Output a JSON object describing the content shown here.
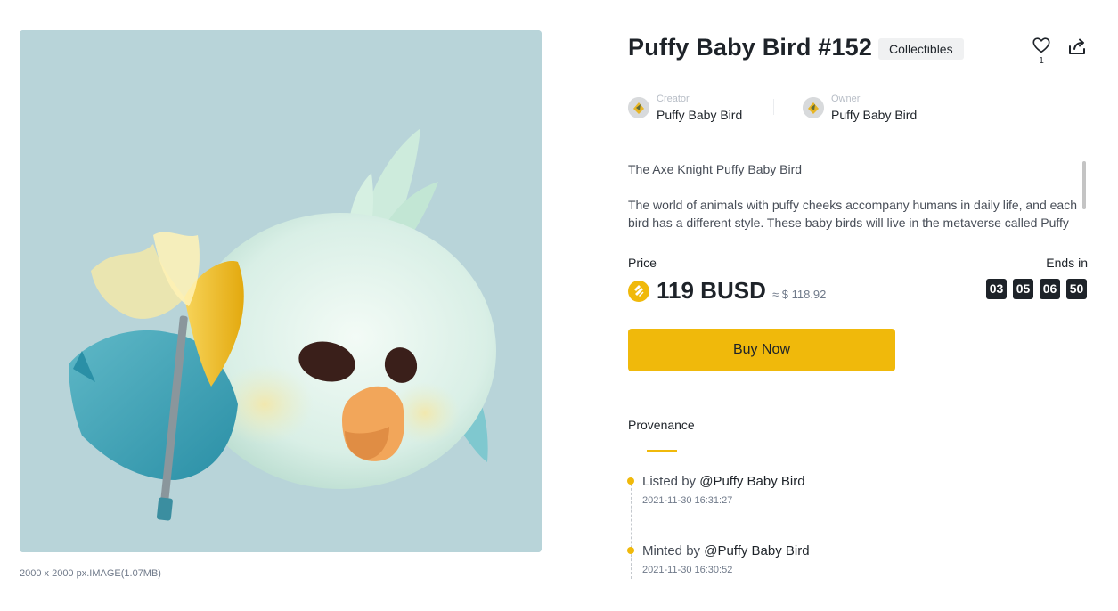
{
  "artwork": {
    "alt": "Puffy Baby Bird #152 artwork",
    "size_info": "2000 x 2000 px.IMAGE(1.07MB)"
  },
  "nft": {
    "title": "Puffy Baby Bird #152",
    "category": "Collectibles",
    "likes": "1"
  },
  "creator": {
    "role": "Creator",
    "name": "Puffy Baby Bird"
  },
  "owner": {
    "role": "Owner",
    "name": "Puffy Baby Bird"
  },
  "description": {
    "line1": "The Axe Knight Puffy Baby Bird",
    "line2": "The world of animals with puffy cheeks accompany humans in daily life, and each bird has a different style. These baby birds will live in the metaverse called Puffy"
  },
  "price": {
    "label": "Price",
    "amount": "119 BUSD",
    "usd": "≈ $ 118.92",
    "ends_label": "Ends in",
    "countdown": [
      "03",
      "05",
      "06",
      "50"
    ]
  },
  "actions": {
    "buy_label": "Buy Now"
  },
  "provenance": {
    "title": "Provenance",
    "events": [
      {
        "action": "Listed by",
        "user": "@Puffy Baby Bird",
        "time": "2021-11-30 16:31:27"
      },
      {
        "action": "Minted by",
        "user": "@Puffy Baby Bird",
        "time": "2021-11-30 16:30:52"
      }
    ]
  },
  "colors": {
    "accent": "#f0b90b",
    "text": "#1e2329",
    "muted": "#707a8a",
    "art_bg": "#b8d4d9"
  },
  "icons": {
    "like": "heart-icon",
    "share": "share-icon",
    "currency": "busd-coin-icon"
  }
}
